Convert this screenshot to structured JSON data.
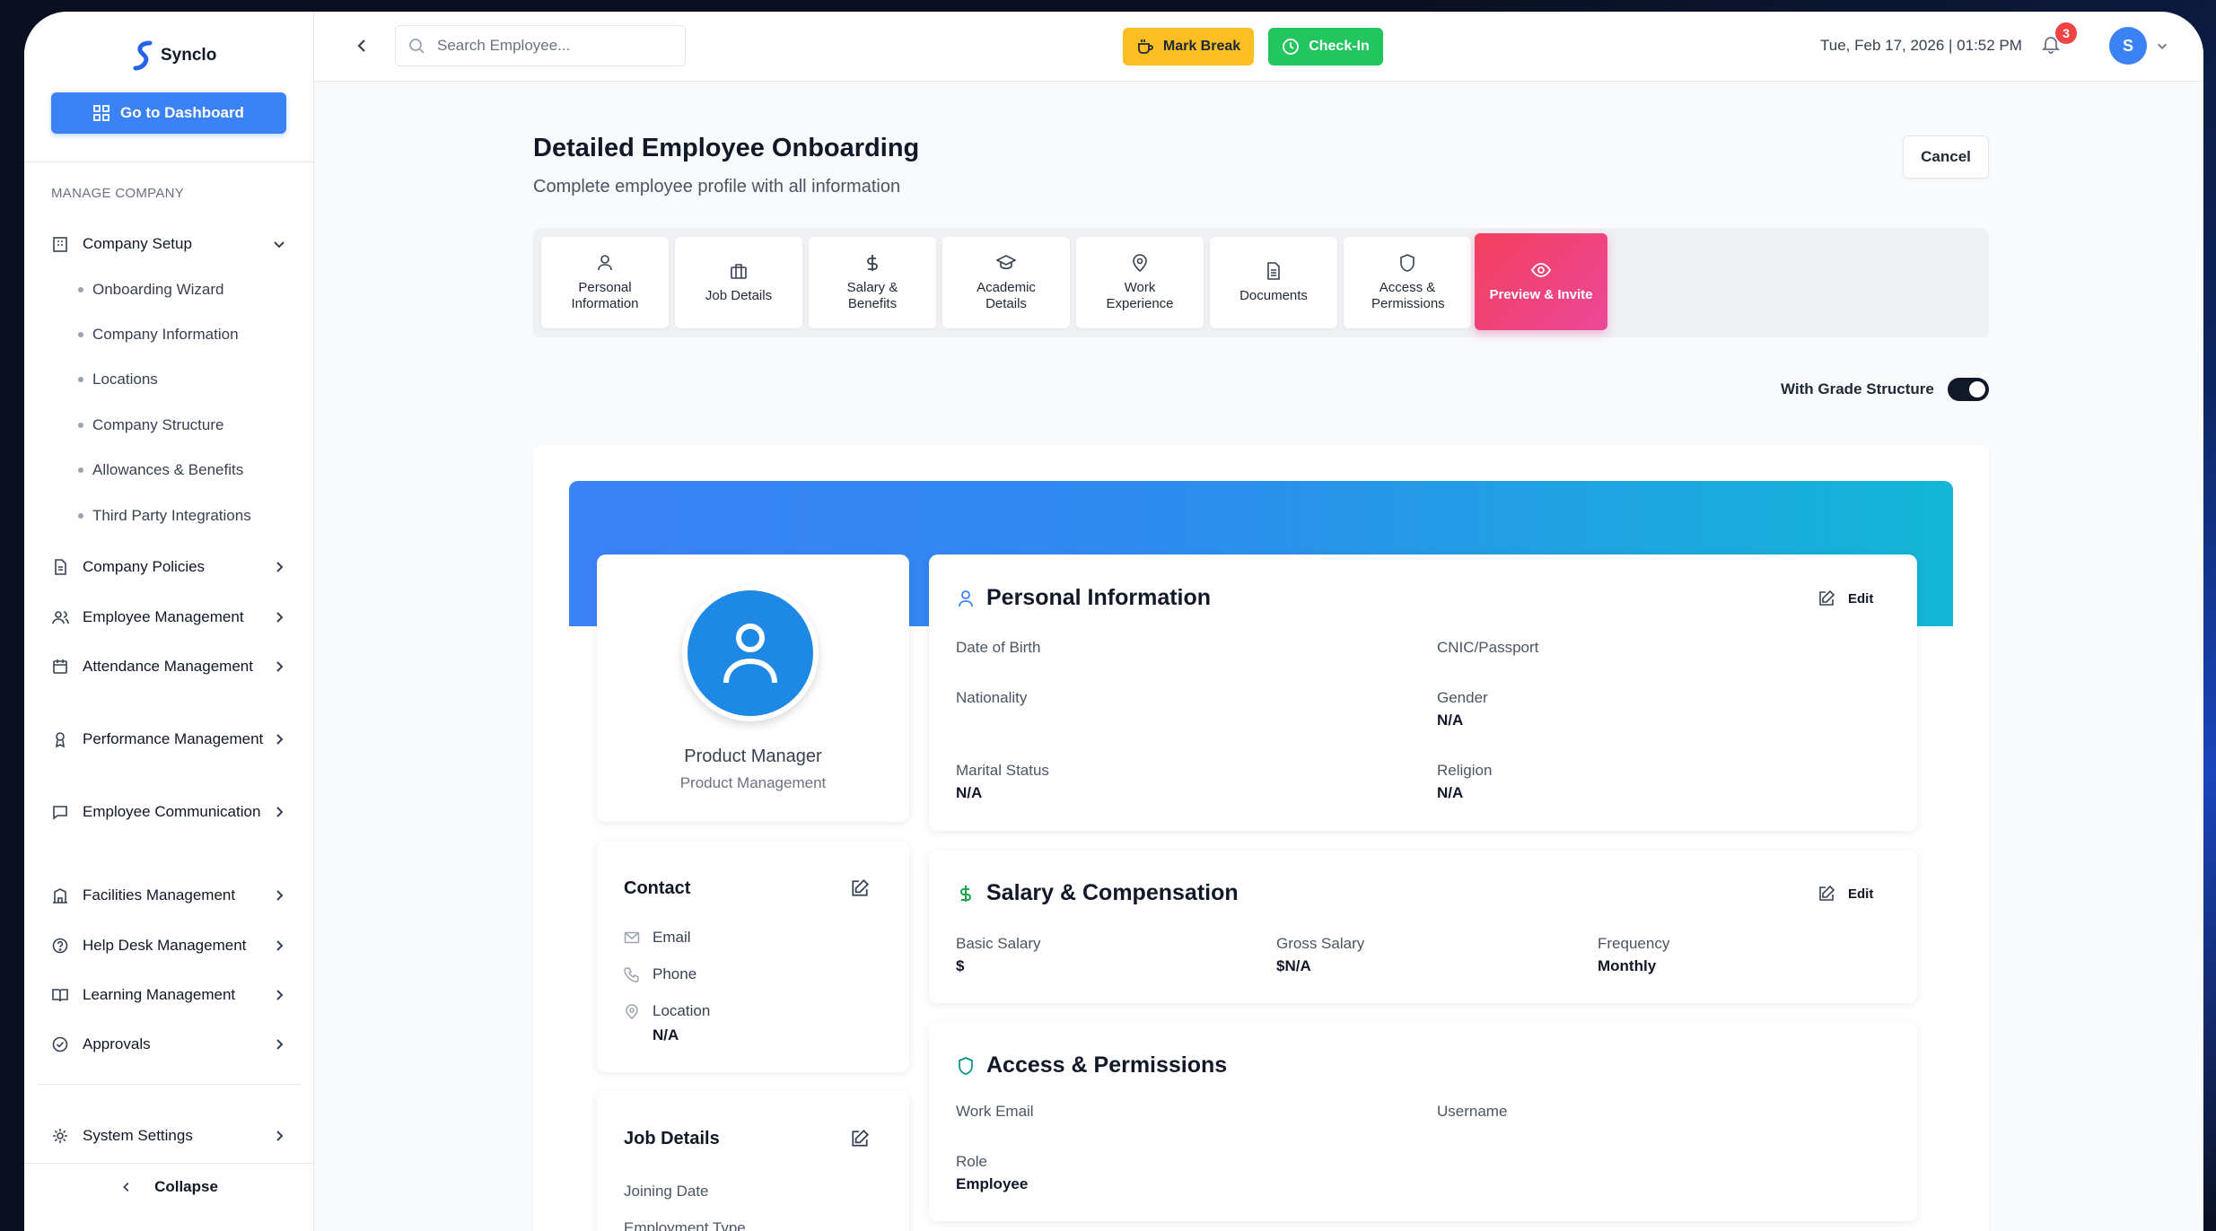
{
  "app": {
    "name": "Synclo"
  },
  "sidebar": {
    "dashboard_button": "Go to Dashboard",
    "section_title": "MANAGE COMPANY",
    "company_setup": {
      "label": "Company Setup",
      "children": [
        "Onboarding Wizard",
        "Company Information",
        "Locations",
        "Company Structure",
        "Allowances & Benefits",
        "Third Party Integrations"
      ]
    },
    "items": [
      {
        "label": "Company Policies",
        "icon": "document-icon"
      },
      {
        "label": "Employee Management",
        "icon": "users-icon"
      },
      {
        "label": "Attendance Management",
        "icon": "calendar-icon"
      },
      {
        "label": "Performance Management",
        "icon": "award-icon"
      },
      {
        "label": "Employee Communication",
        "icon": "chat-icon"
      },
      {
        "label": "Facilities Management",
        "icon": "building-icon"
      },
      {
        "label": "Help Desk Management",
        "icon": "help-icon"
      },
      {
        "label": "Learning Management",
        "icon": "book-icon"
      },
      {
        "label": "Approvals",
        "icon": "check-circle-icon"
      }
    ],
    "system_settings": "System Settings",
    "collapse": "Collapse"
  },
  "topbar": {
    "search_placeholder": "Search Employee...",
    "mark_break": "Mark Break",
    "check_in": "Check-In",
    "datetime": "Tue, Feb 17, 2026 | 01:52 PM",
    "notification_count": "3",
    "avatar_initial": "S"
  },
  "page": {
    "title": "Detailed Employee Onboarding",
    "subtitle": "Complete employee profile with all information",
    "cancel": "Cancel",
    "grade_structure_label": "With Grade Structure",
    "grade_structure_on": true
  },
  "tabs": [
    {
      "label": "Personal Information",
      "icon": "user-icon"
    },
    {
      "label": "Job Details",
      "icon": "briefcase-icon"
    },
    {
      "label": "Salary & Benefits",
      "icon": "dollar-icon"
    },
    {
      "label": "Academic Details",
      "icon": "graduation-cap-icon"
    },
    {
      "label": "Work Experience",
      "icon": "map-pin-icon"
    },
    {
      "label": "Documents",
      "icon": "file-icon"
    },
    {
      "label": "Access & Permissions",
      "icon": "shield-icon"
    },
    {
      "label": "Preview & Invite",
      "icon": "eye-icon",
      "active": true
    }
  ],
  "profile": {
    "title": "Product Manager",
    "department": "Product Management"
  },
  "contact": {
    "title": "Contact",
    "email_label": "Email",
    "phone_label": "Phone",
    "location_label": "Location",
    "location_value": "N/A"
  },
  "job_details": {
    "title": "Job Details",
    "joining_date_label": "Joining Date",
    "employment_type_label": "Employment Type"
  },
  "personal_info": {
    "title": "Personal Information",
    "edit": "Edit",
    "dob_label": "Date of Birth",
    "cnic_label": "CNIC/Passport",
    "nationality_label": "Nationality",
    "gender_label": "Gender",
    "gender_value": "N/A",
    "marital_label": "Marital Status",
    "marital_value": "N/A",
    "religion_label": "Religion",
    "religion_value": "N/A"
  },
  "salary": {
    "title": "Salary & Compensation",
    "edit": "Edit",
    "basic_label": "Basic Salary",
    "basic_value": "$",
    "gross_label": "Gross Salary",
    "gross_value": "$N/A",
    "frequency_label": "Frequency",
    "frequency_value": "Monthly"
  },
  "access": {
    "title": "Access & Permissions",
    "work_email_label": "Work Email",
    "username_label": "Username",
    "role_label": "Role",
    "role_value": "Employee"
  },
  "colors": {
    "primary": "#3b82f6",
    "break": "#fbbf24",
    "checkin": "#22c55e",
    "active_tab": "#ec4899",
    "badge": "#ef4444"
  }
}
